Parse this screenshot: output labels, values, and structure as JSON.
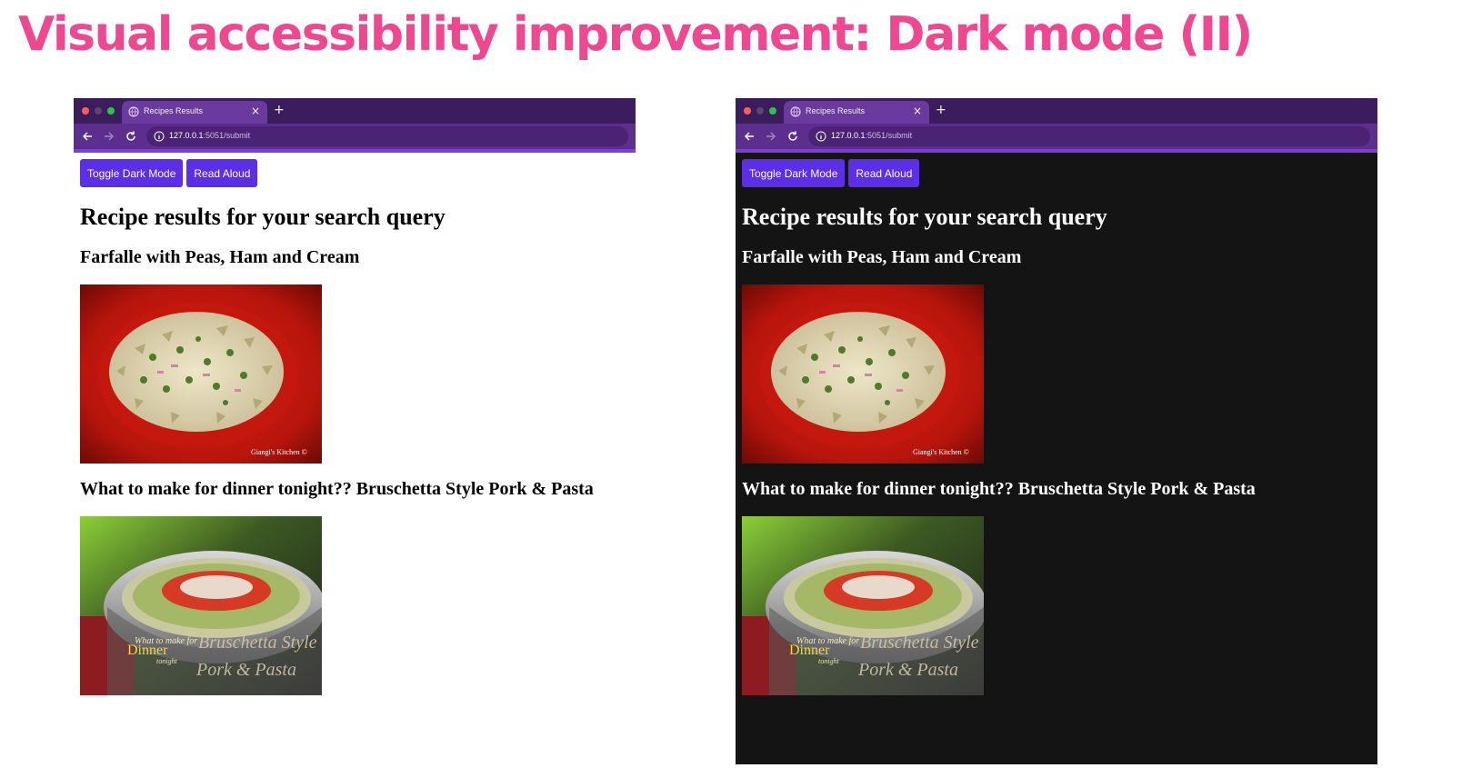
{
  "slide": {
    "title": "Visual accessibility improvement: Dark mode (II)"
  },
  "colors": {
    "title_pink": "#ef4891",
    "browser_frame": "#3b1c5c",
    "button_purple": "#5b2ee8",
    "dark_background": "#141414"
  },
  "browser": {
    "tab_title": "Recipes Results",
    "tab_close_glyph": "×",
    "new_tab_glyph": "+",
    "url_host": "127.0.0.1",
    "url_rest": ":5051/submit"
  },
  "page": {
    "buttons": {
      "toggle_dark_mode": "Toggle Dark Mode",
      "read_aloud": "Read Aloud"
    },
    "heading": "Recipe results for your search query",
    "recipes": [
      {
        "title": "Farfalle with Peas, Ham and Cream",
        "image_caption": "Giangi's Kitchen ©"
      },
      {
        "title": "What to make for dinner tonight?? Bruschetta Style Pork & Pasta",
        "image_overlay_1": "What to make for",
        "image_overlay_2": "Dinner",
        "image_overlay_3": "tonight",
        "image_overlay_4": "Bruschetta Style",
        "image_overlay_5": "Pork & Pasta"
      }
    ]
  },
  "panels": [
    {
      "mode": "light"
    },
    {
      "mode": "dark"
    }
  ]
}
